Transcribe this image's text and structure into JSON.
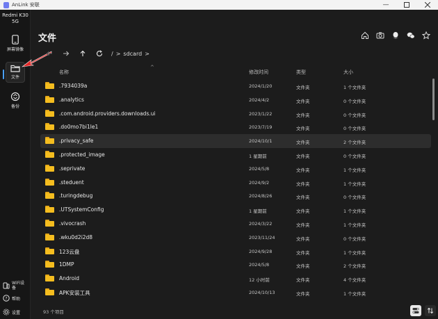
{
  "window": {
    "title": "AnLink 安联"
  },
  "sidebar": {
    "device": "Redmi K30 5G",
    "items": [
      {
        "label": "屏幕镜像"
      },
      {
        "label": "文件"
      },
      {
        "label": "备份"
      }
    ],
    "bottom": [
      {
        "label": "WiFi设备"
      },
      {
        "label": "帮助"
      },
      {
        "label": "设置"
      }
    ]
  },
  "header": {
    "title": "文件"
  },
  "path": {
    "root": "/",
    "sep": ">",
    "folder": "sdcard",
    "sep2": ">"
  },
  "table": {
    "columns": [
      "名称",
      "修改时间",
      "类型",
      "大小"
    ],
    "rows": [
      {
        "name": ".7934039a",
        "date": "2024/1/20",
        "type": "文件夹",
        "size": "1 个文件夹"
      },
      {
        "name": ".analytics",
        "date": "2024/4/2",
        "type": "文件夹",
        "size": "0 个文件夹"
      },
      {
        "name": ".com.android.providers.downloads.ui",
        "date": "2023/1/22",
        "type": "文件夹",
        "size": "0 个文件夹"
      },
      {
        "name": ".do0mo7bi1le1",
        "date": "2023/7/19",
        "type": "文件夹",
        "size": "0 个文件夹"
      },
      {
        "name": ".privacy_safe",
        "date": "2024/10/1",
        "type": "文件夹",
        "size": "2 个文件夹"
      },
      {
        "name": ".protected_image",
        "date": "1 星期前",
        "type": "文件夹",
        "size": "0 个文件夹"
      },
      {
        "name": ".seprivate",
        "date": "2024/5/8",
        "type": "文件夹",
        "size": "1 个文件夹"
      },
      {
        "name": ".steduent",
        "date": "2024/9/2",
        "type": "文件夹",
        "size": "1 个文件夹"
      },
      {
        "name": ".turingdebug",
        "date": "2024/8/26",
        "type": "文件夹",
        "size": "0 个文件夹"
      },
      {
        "name": ".UTSystemConfig",
        "date": "1 星期前",
        "type": "文件夹",
        "size": "1 个文件夹"
      },
      {
        "name": ".vivocrash",
        "date": "2024/3/22",
        "type": "文件夹",
        "size": "1 个文件夹"
      },
      {
        "name": ".wku0d2i2d8",
        "date": "2023/11/24",
        "type": "文件夹",
        "size": "0 个文件夹"
      },
      {
        "name": "123云盘",
        "date": "2024/9/28",
        "type": "文件夹",
        "size": "1 个文件夹"
      },
      {
        "name": "1DMP",
        "date": "2024/5/8",
        "type": "文件夹",
        "size": "2 个文件夹"
      },
      {
        "name": "Android",
        "date": "12 小时前",
        "type": "文件夹",
        "size": "4 个文件夹"
      },
      {
        "name": "APK安装工具",
        "date": "2024/10/13",
        "type": "文件夹",
        "size": "1 个文件夹"
      }
    ],
    "selected_index": 4
  },
  "footer": {
    "count": "93 个项目"
  },
  "colors": {
    "accent": "#4a9fff",
    "folder": "#f5bd1f",
    "annotation_arrow": "#e52b2b"
  }
}
